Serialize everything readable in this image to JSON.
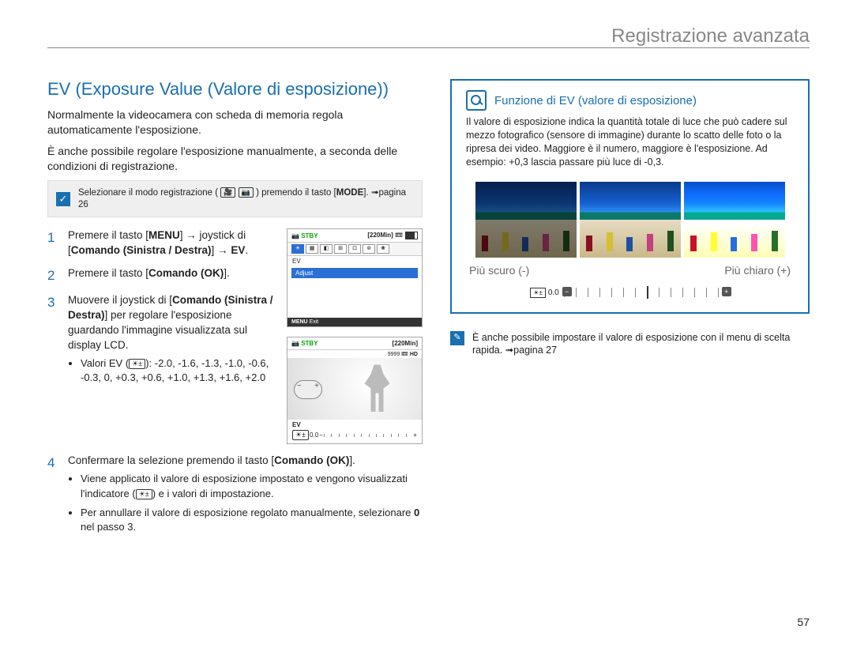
{
  "header": {
    "title": "Registrazione avanzata"
  },
  "section_title": "EV (Exposure Value (Valore di esposizione))",
  "intro1": "Normalmente la videocamera con scheda di memoria regola automaticamente l'esposizione.",
  "intro2": "È anche possibile regolare l'esposizione manualmente, a seconda delle condizioni di registrazione.",
  "precheck": {
    "text_a": "Selezionare il modo registrazione (",
    "text_b": ") premendo il tasto [",
    "mode": "MODE",
    "text_c": "]. ",
    "page_ref": "➟pagina 26"
  },
  "steps": {
    "s1a": "Premere il tasto [",
    "s1_menu": "MENU",
    "s1b": "] → joystick di [",
    "s1_cmd": "Comando (Sinistra / Destra)",
    "s1c": "] → ",
    "s1_ev": "EV",
    "s1d": ".",
    "s2a": "Premere il tasto [",
    "s2_cmd": "Comando (OK)",
    "s2b": "].",
    "s3a": "Muovere il joystick di [",
    "s3_cmd": "Comando (Sinistra / Destra)",
    "s3b": "] per regolare l'esposizione guardando l'immagine visualizzata sul display LCD.",
    "s3_values_label": "Valori EV (",
    "s3_values": "): -2.0, -1.6, -1.3, -1.0, -0.6, -0.3, 0, +0.3, +0.6, +1.0, +1.3, +1.6, +2.0",
    "s4a": "Confermare la selezione premendo il tasto [",
    "s4_cmd": "Comando (OK)",
    "s4b": "].",
    "s4_bullet1a": "Viene applicato il valore di esposizione impostato e vengono visualizzati l'indicatore (",
    "s4_bullet1b": ") e i valori di impostazione.",
    "s4_bullet2a": "Per annullare il valore di esposizione regolato manualmente, selezionare ",
    "s4_bullet2_zero": "0",
    "s4_bullet2b": " nel passo 3."
  },
  "lcd1": {
    "stby": "STBY",
    "time": "[220Min]",
    "ev": "EV",
    "adjust": "Adjust",
    "menu": "MENU",
    "exit": "Exit"
  },
  "lcd2": {
    "stby": "STBY",
    "time": "[220Min]",
    "count": "9999",
    "ev": "EV",
    "val": "0.0"
  },
  "right": {
    "title": "Funzione di EV (valore di esposizione)",
    "text": "Il valore di esposizione indica la quantità totale di luce che può cadere sul mezzo fotografico (sensore di immagine) durante lo scatto delle foto o la ripresa dei video. Maggiore è il numero, maggiore è l'esposizione. Ad esempio: +0,3 lascia passare più luce di -0,3.",
    "darker": "Più scuro (-)",
    "lighter": "Più chiaro (+)",
    "scale_val": "0.0"
  },
  "note": {
    "text": "È anche possibile impostare il valore di esposizione con il menu di scelta rapida. ➟pagina 27"
  },
  "page_number": "57"
}
